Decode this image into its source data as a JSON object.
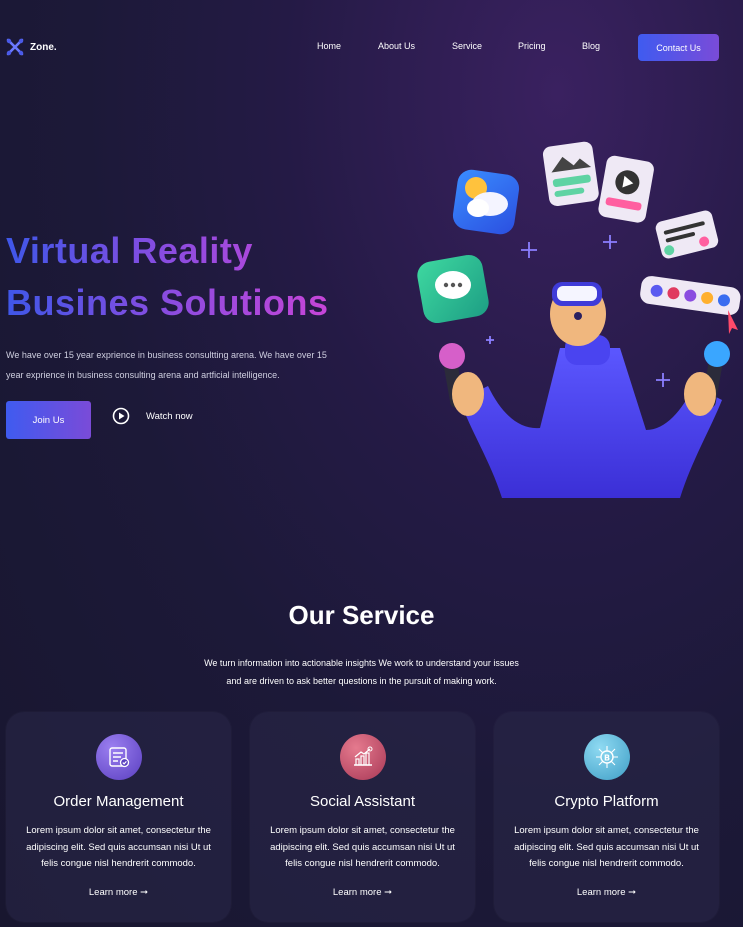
{
  "nav": {
    "logo_text": "Zone.",
    "items": [
      {
        "label": "Home"
      },
      {
        "label": "About Us"
      },
      {
        "label": "Service"
      },
      {
        "label": "Pricing"
      },
      {
        "label": "Blog"
      }
    ],
    "contact_label": "Contact Us"
  },
  "hero": {
    "title_line1": "Virtual Reality",
    "title_line2": "Busines Solutions",
    "description": "We have over 15 year exprience in business consultting arena. We have over 15 year exprience in business consulting arena and artficial intelligence.",
    "join_label": "Join Us",
    "watch_label": "Watch now"
  },
  "service": {
    "title": "Our Service",
    "desc_line1": "We turn information into actionable insights We work to understand your issues",
    "desc_line2": "and are driven to ask better questions in the pursuit of making work.",
    "cards": [
      {
        "title": "Order Management",
        "text": "Lorem ipsum dolor sit amet, consectetur the adipiscing elit. Sed quis accumsan nisi Ut ut felis congue nisl hendrerit commodo.",
        "link": "Learn more",
        "icon": "order-list-icon",
        "color": "#7b5bd0"
      },
      {
        "title": "Social Assistant",
        "text": "Lorem ipsum dolor sit amet, consectetur the adipiscing elit. Sed quis accumsan nisi Ut ut felis congue nisl hendrerit commodo.",
        "link": "Learn more",
        "icon": "growth-chart-icon",
        "color": "#c74f6e"
      },
      {
        "title": "Crypto Platform",
        "text": "Lorem ipsum dolor sit amet, consectetur the adipiscing elit. Sed quis accumsan nisi Ut ut felis congue nisl hendrerit commodo.",
        "link": "Learn more",
        "icon": "bitcoin-network-icon",
        "color": "#5fbfe0"
      }
    ]
  },
  "colors": {
    "accent_start": "#3f5bf0",
    "accent_end": "#7a4bd8",
    "background": "#1c1938"
  }
}
